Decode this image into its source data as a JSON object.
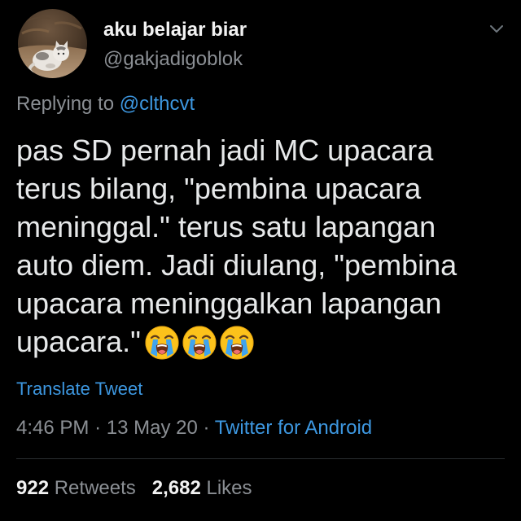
{
  "user": {
    "display_name": "aku belajar biar",
    "handle": "@gakjadigoblok"
  },
  "header": {
    "menu_icon": "chevron-down-icon"
  },
  "reply": {
    "prefix": "Replying to",
    "mention": "@clthcvt"
  },
  "tweet": {
    "lines": [
      "pas SD pernah jadi MC upacara",
      "terus bilang, \"pembina upacara",
      "meninggal.\" terus satu lapangan",
      "auto diem. Jadi diulang, \"pembina",
      "upacara meninggalkan lapangan",
      "upacara.\""
    ],
    "emoji_icons": [
      "loudly-crying-face-icon",
      "loudly-crying-face-icon",
      "loudly-crying-face-icon"
    ]
  },
  "translate": {
    "label": "Translate Tweet"
  },
  "meta": {
    "time": "4:46 PM",
    "separator": "·",
    "date": "13 May 20",
    "source": "Twitter for Android"
  },
  "stats": {
    "retweets_count": "922",
    "retweets_label": "Retweets",
    "likes_count": "2,682",
    "likes_label": "Likes"
  },
  "colors": {
    "background": "#000000",
    "text": "#e7e9ea",
    "muted": "#8b8f94",
    "link": "#3d97e0",
    "divider": "#2a2d30"
  }
}
